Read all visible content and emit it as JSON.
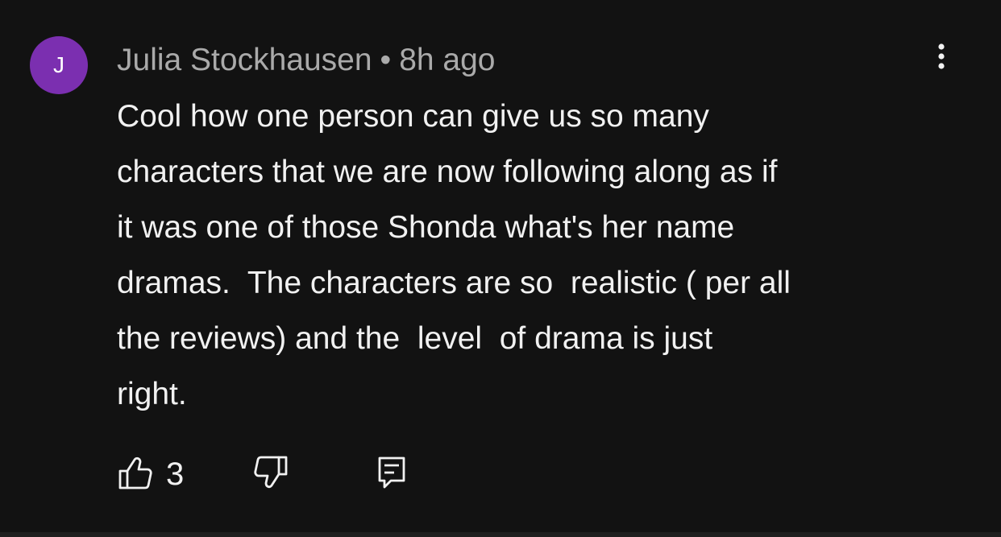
{
  "comment": {
    "avatar_initial": "J",
    "author": "Julia Stockhausen",
    "separator": "•",
    "time": "8h ago",
    "text": "Cool how one person can give us so many\ncharacters that we are now following along as if\nit was one of those Shonda what's her name\ndramas.  The characters are so  realistic ( per all\nthe reviews) and the  level  of drama is just\nright.",
    "like_count": "3"
  },
  "colors": {
    "background": "#121212",
    "avatar": "#7b2fb0",
    "text": "#f1f1f1",
    "meta": "#aaaaaa"
  },
  "icons": {
    "more": "more-vertical-icon",
    "like": "thumb-up-icon",
    "dislike": "thumb-down-icon",
    "reply": "comment-reply-icon"
  }
}
